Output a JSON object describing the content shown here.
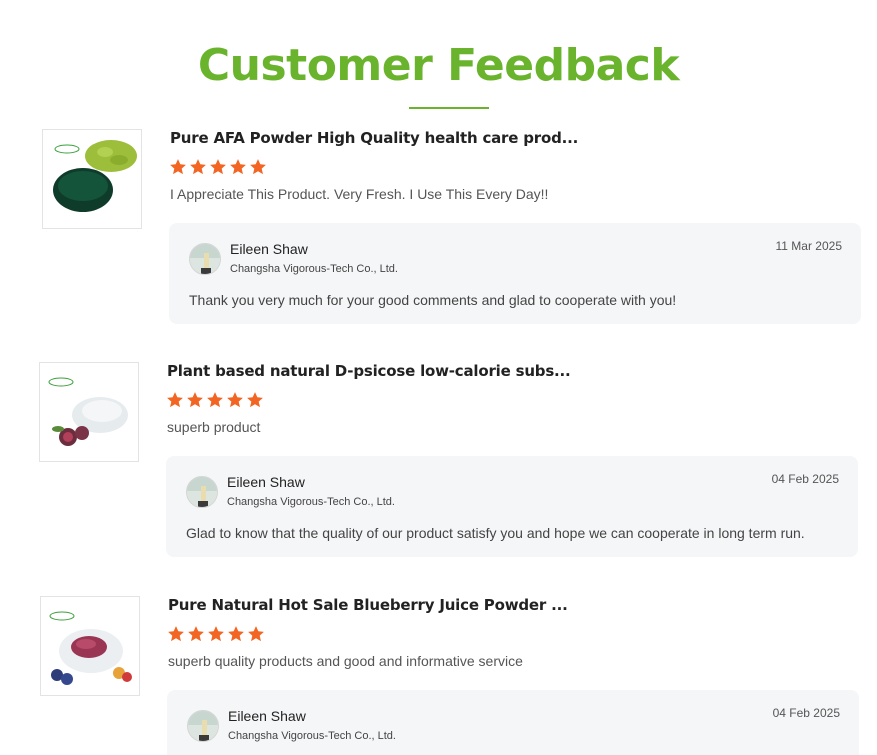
{
  "page": {
    "title": "Customer Feedback"
  },
  "colors": {
    "brand_green": "#6ab42d",
    "star_orange": "#f26522",
    "reply_bg": "#f5f6f8"
  },
  "reviews": [
    {
      "product_name": "Pure AFA Powder High Quality health care prod...",
      "rating": 5,
      "comment": "I Appreciate This Product. Very Fresh. I Use This Every Day!!",
      "reply": {
        "author": "Eileen Shaw",
        "company": "Changsha Vigorous-Tech Co., Ltd.",
        "date": "11 Mar 2025",
        "text": "Thank you very much for your good comments and glad to cooperate with you!"
      }
    },
    {
      "product_name": "Plant based natural D-psicose low-calorie subs...",
      "rating": 5,
      "comment": "superb product",
      "reply": {
        "author": "Eileen Shaw",
        "company": "Changsha Vigorous-Tech Co., Ltd.",
        "date": "04 Feb 2025",
        "text": "Glad to know that the quality of our product satisfy you and hope we can cooperate in long term run."
      }
    },
    {
      "product_name": "Pure Natural Hot Sale Blueberry Juice Powder ...",
      "rating": 5,
      "comment": "superb quality products and good and informative service",
      "reply": {
        "author": "Eileen Shaw",
        "company": "Changsha Vigorous-Tech Co., Ltd.",
        "date": "04 Feb 2025",
        "text": ""
      }
    }
  ]
}
